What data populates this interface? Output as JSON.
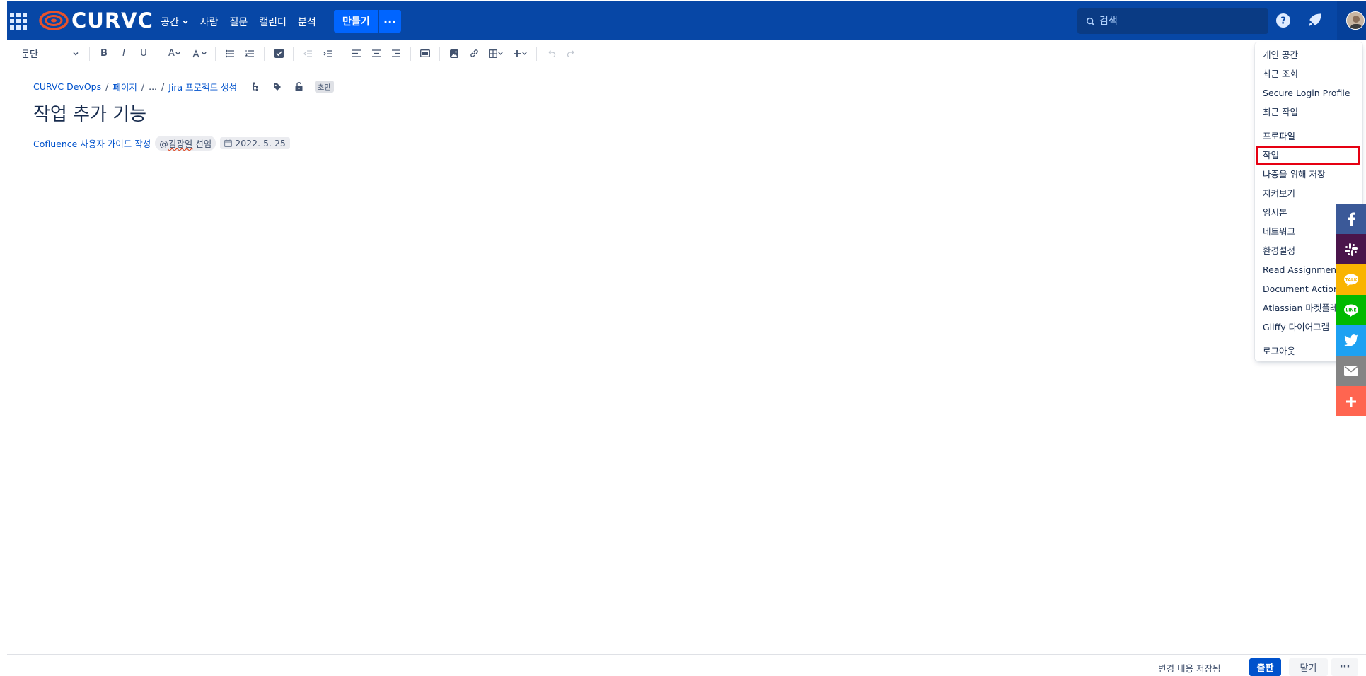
{
  "header": {
    "brand": "CURVC",
    "nav": [
      {
        "label": "공간",
        "has_dropdown": true
      },
      {
        "label": "사람"
      },
      {
        "label": "질문"
      },
      {
        "label": "캘린더"
      },
      {
        "label": "분석"
      }
    ],
    "create_label": "만들기",
    "create_more_label": "···",
    "search_placeholder": "검색"
  },
  "toolbar": {
    "paragraph_label": "문단",
    "bold": "B",
    "italic": "I",
    "underline": "U",
    "text_color": "A"
  },
  "page": {
    "breadcrumb": [
      "CURVC DevOps",
      "페이지",
      "...",
      "Jira 프로젝트 생성"
    ],
    "draft_badge": "초안",
    "title": "작업 추가 기능",
    "body_link": "Cofluence 사용자 가이드 작성",
    "mention_at": "@",
    "mention_name": "김광일",
    "mention_suffix": " 선임",
    "date": "2022. 5. 25"
  },
  "profile_menu": {
    "items": [
      {
        "label": "개인 공간"
      },
      {
        "label": "최근 조회"
      },
      {
        "label": "Secure Login Profile"
      },
      {
        "label": "최근 작업"
      },
      {
        "label": "프로파일"
      },
      {
        "label": "작업",
        "highlighted": true
      },
      {
        "label": "나중을 위해 저장"
      },
      {
        "label": "지켜보기"
      },
      {
        "label": "임시본"
      },
      {
        "label": "네트워크"
      },
      {
        "label": "환경설정"
      },
      {
        "label": "Read Assignments"
      },
      {
        "label": "Document Actions"
      },
      {
        "label": "Atlassian 마켓플레이스"
      },
      {
        "label": "Gliffy 다이어그램"
      },
      {
        "label": "로그아웃"
      }
    ]
  },
  "share_bar": [
    {
      "icon": "facebook-icon",
      "color": "#3b5998",
      "glyph": "f"
    },
    {
      "icon": "slack-icon",
      "color": "#4a154b",
      "glyph": "#"
    },
    {
      "icon": "kakaotalk-icon",
      "color": "#f9b400",
      "glyph": "TALK"
    },
    {
      "icon": "line-icon",
      "color": "#00b900",
      "glyph": "LINE"
    },
    {
      "icon": "twitter-icon",
      "color": "#1da1f2",
      "glyph": "t"
    },
    {
      "icon": "email-icon",
      "color": "#848484",
      "glyph": "✉"
    },
    {
      "icon": "more-share-icon",
      "color": "#ff6550",
      "glyph": "+"
    }
  ],
  "footer": {
    "saved_text": "변경 내용 저장됨",
    "publish_label": "출판",
    "close_label": "닫기",
    "more_label": "···"
  },
  "colors": {
    "header_bg": "#0747a6",
    "primary": "#0052cc",
    "highlight_outline": "#e60012",
    "logo_orange": "#e8522b"
  }
}
